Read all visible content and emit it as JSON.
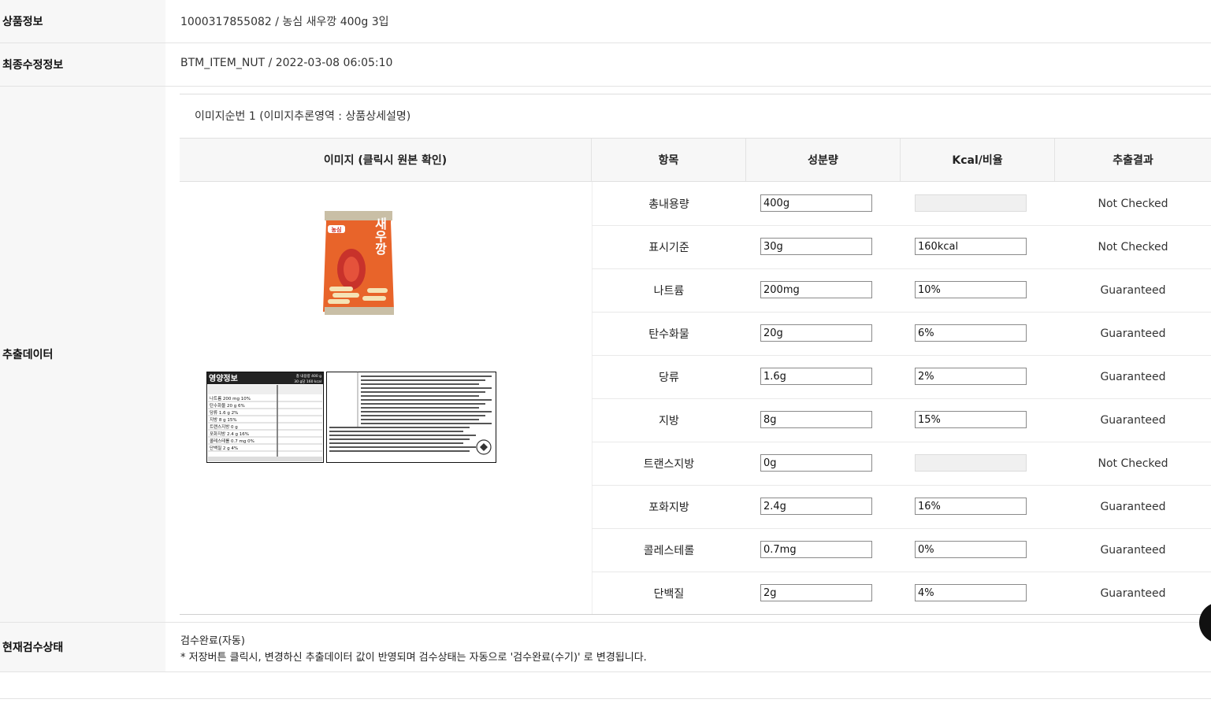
{
  "product_info": {
    "label": "상품정보",
    "value": "1000317855082 / 농심 새우깡 400g 3입"
  },
  "last_modified": {
    "label": "최종수정정보",
    "value": "BTM_ITEM_NUT / 2022-03-08 06:05:10"
  },
  "extraction": {
    "label": "추출데이터",
    "image_seq": "이미지순번 1 (이미지추론영역 : 상품상세설명)",
    "headers": {
      "image": "이미지 (클릭시 원본 확인)",
      "item": "항목",
      "amount": "성분량",
      "kcal_ratio": "Kcal/비율",
      "result": "추출결과"
    },
    "rows": [
      {
        "item": "총내용량",
        "amount": "400g",
        "ratio": "",
        "ratio_disabled": true,
        "result": "Not Checked"
      },
      {
        "item": "표시기준",
        "amount": "30g",
        "ratio": "160kcal",
        "ratio_disabled": false,
        "result": "Not Checked"
      },
      {
        "item": "나트륨",
        "amount": "200mg",
        "ratio": "10%",
        "ratio_disabled": false,
        "result": "Guaranteed"
      },
      {
        "item": "탄수화물",
        "amount": "20g",
        "ratio": "6%",
        "ratio_disabled": false,
        "result": "Guaranteed"
      },
      {
        "item": "당류",
        "amount": "1.6g",
        "ratio": "2%",
        "ratio_disabled": false,
        "result": "Guaranteed"
      },
      {
        "item": "지방",
        "amount": "8g",
        "ratio": "15%",
        "ratio_disabled": false,
        "result": "Guaranteed"
      },
      {
        "item": "트랜스지방",
        "amount": "0g",
        "ratio": "",
        "ratio_disabled": true,
        "result": "Not Checked"
      },
      {
        "item": "포화지방",
        "amount": "2.4g",
        "ratio": "16%",
        "ratio_disabled": false,
        "result": "Guaranteed"
      },
      {
        "item": "콜레스테롤",
        "amount": "0.7mg",
        "ratio": "0%",
        "ratio_disabled": false,
        "result": "Guaranteed"
      },
      {
        "item": "단백질",
        "amount": "2g",
        "ratio": "4%",
        "ratio_disabled": false,
        "result": "Guaranteed"
      }
    ],
    "images": {
      "bag_brand": "농심",
      "bag_name": "새우깡",
      "nutrition_title": "영양정보",
      "nutrition_total": "총 내용량 400 g",
      "nutrition_serving": "30 g당 160 kcal",
      "nutrition_rows": [
        "나트륨 200 mg 10%",
        "탄수화물 20 g 6%",
        "당류 1.6 g 2%",
        "지방 8 g 15%",
        "트랜스지방 0 g",
        "포화지방 2.4 g 16%",
        "콜레스테롤 0.7 mg 0%",
        "단백질 2 g 4%"
      ]
    }
  },
  "review_status": {
    "label": "현재검수상태",
    "value": "검수완료(자동)",
    "note": "* 저장버튼 클릭시, 변경하신 추출데이터 값이 반영되며 검수상태는 자동으로 '검수완료(수기)' 로 변경됩니다."
  },
  "colors": {
    "label_bg": "#f7f7f7",
    "header_bg": "#f7f7f7",
    "bag_orange": "#e8642a",
    "floating_button": "#111111"
  }
}
